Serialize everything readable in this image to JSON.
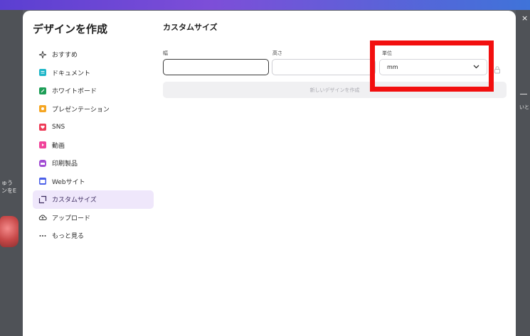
{
  "dialog": {
    "title": "デザインを作成",
    "close_glyph": "×"
  },
  "nav": {
    "items": [
      {
        "label": "おすすめ",
        "icon": "sparkle-icon",
        "color": "#444444"
      },
      {
        "label": "ドキュメント",
        "icon": "document-icon",
        "color": "#1fb6c8"
      },
      {
        "label": "ホワイトボード",
        "icon": "whiteboard-icon",
        "color": "#1d9e57"
      },
      {
        "label": "プレゼンテーション",
        "icon": "presentation-icon",
        "color": "#f5a623"
      },
      {
        "label": "SNS",
        "icon": "heart-icon",
        "color": "#ee3b57"
      },
      {
        "label": "動画",
        "icon": "video-icon",
        "color": "#f0449b"
      },
      {
        "label": "印刷製品",
        "icon": "print-icon",
        "color": "#a34fd4"
      },
      {
        "label": "Webサイト",
        "icon": "website-icon",
        "color": "#4a5fe8"
      },
      {
        "label": "カスタムサイズ",
        "icon": "custom-size-icon",
        "color": "#3b2a5e",
        "active": true
      },
      {
        "label": "アップロード",
        "icon": "upload-icon",
        "color": "#333333"
      },
      {
        "label": "もっと見る",
        "icon": "more-icon",
        "color": "#333333"
      }
    ]
  },
  "custom_size": {
    "title": "カスタムサイズ",
    "width_label": "幅",
    "width_value": "",
    "height_label": "高さ",
    "height_value": "",
    "unit_label": "単位",
    "unit_value": "mm",
    "create_button": "新しいデザインを作成"
  },
  "background": {
    "left_text_line1": "ゅう",
    "left_text_line2": "ンをE",
    "right_text": "いと"
  },
  "colors": {
    "accent": "#8b3dff",
    "active_nav_bg": "#efe7fb",
    "highlight": "#f20f0f"
  }
}
